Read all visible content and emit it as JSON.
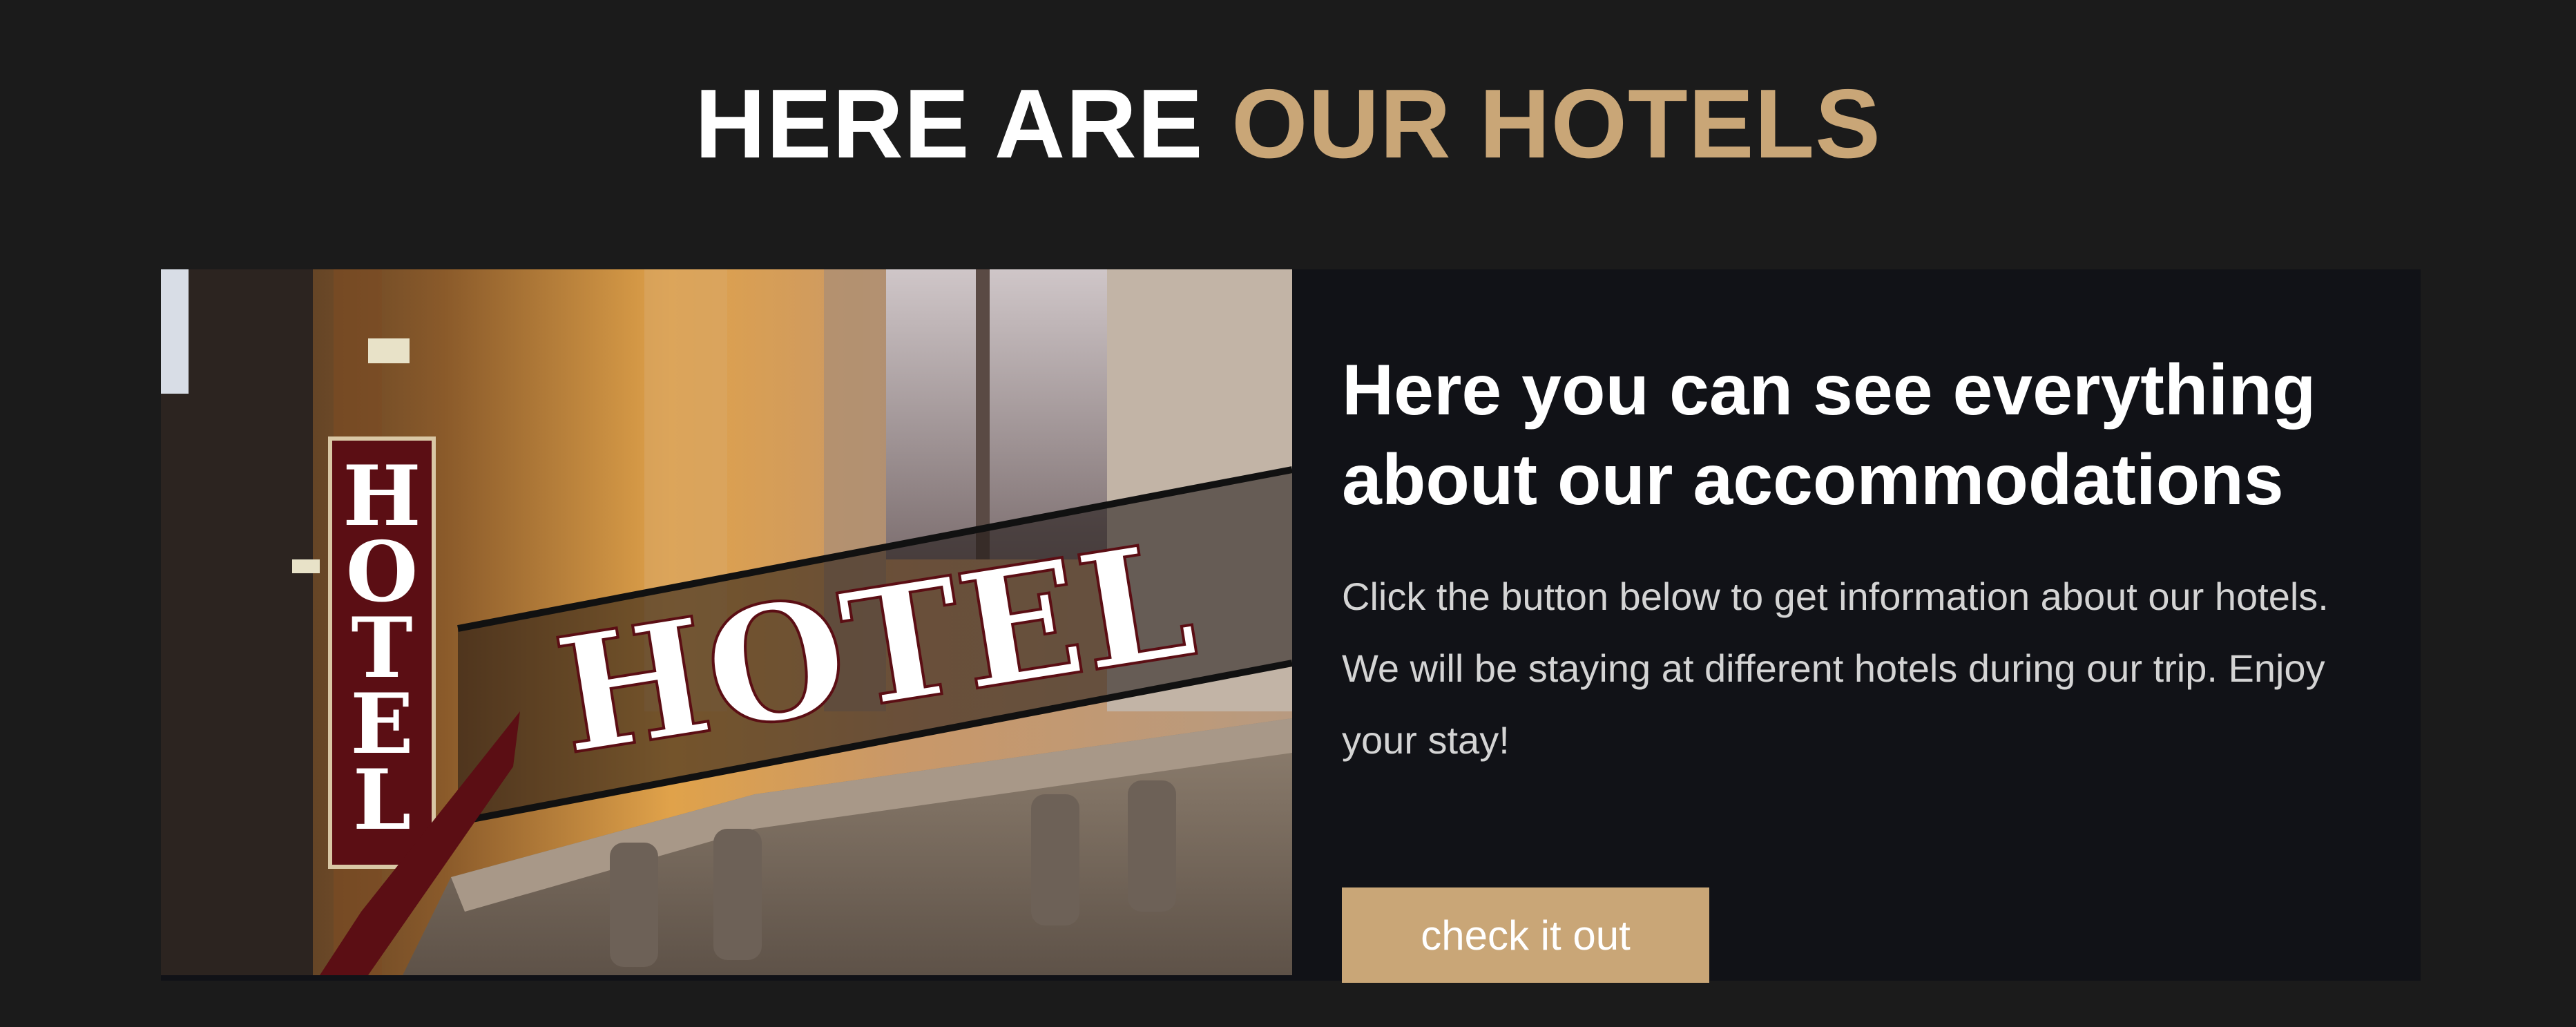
{
  "section": {
    "title_main": "HERE ARE",
    "title_accent": "OUR HOTELS"
  },
  "card": {
    "image_sign_text": "HOTEL",
    "heading": "Here you can see everything about our accommodations",
    "body": "Click the button below to get information about our hotels. We will be staying at different hotels during our trip. Enjoy your stay!",
    "button_label": "check it out"
  },
  "colors": {
    "background": "#1b1b1b",
    "card_background": "#111217",
    "accent": "#c9a677",
    "heading": "#ffffff",
    "body_text": "#d4d4d4"
  }
}
